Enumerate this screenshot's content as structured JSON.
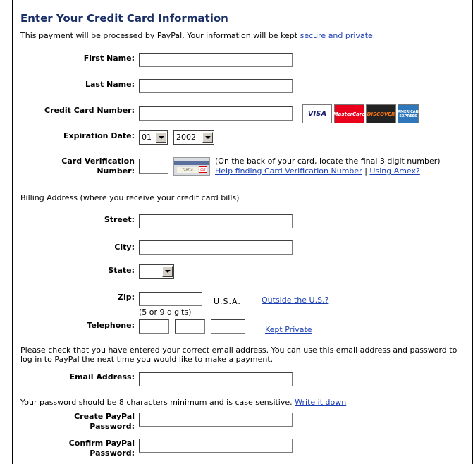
{
  "header": {
    "title": "Enter Your Credit Card Information",
    "intro_text": "This payment will be processed by PayPal. Your information will be kept",
    "intro_link": "secure and private."
  },
  "card_section": {
    "first_name_label": "First Name:",
    "last_name_label": "Last Name:",
    "card_number_label": "Credit Card Number:",
    "card_logos": [
      "VISA",
      "MasterCard",
      "DISCOVER",
      "AMERICAN EXPRESS"
    ],
    "expiration_label": "Expiration Date:",
    "exp_month": "01",
    "exp_year": "2002",
    "cvv_label_line1": "Card Verification",
    "cvv_label_line2": "Number:",
    "cvv_card_digits": "719718",
    "cvv_card_code": "017",
    "cvv_help_text": "(On the back of your card, locate the final 3 digit number)",
    "cvv_help_link": "Help finding Card Verification Number",
    "separator": "|",
    "amex_link": "Using Amex?"
  },
  "billing": {
    "heading": "Billing Address (where you receive your credit card bills)",
    "street_label": "Street:",
    "city_label": "City:",
    "state_label": "State:",
    "zip_label": "Zip:",
    "country_text": "U.S.A.",
    "outside_link": "Outside the U.S.?",
    "zip_hint": "(5 or 9 digits)",
    "telephone_label": "Telephone:",
    "kept_private_link": "Kept Private"
  },
  "account": {
    "email_note": "Please check that you have entered your correct email address. You can use this email address and password to log in to PayPal the next time you would like to make a payment.",
    "email_label": "Email Address:",
    "password_note": "Your password should be 8 characters minimum and is case sensitive.",
    "write_it_down_link": "Write it down",
    "create_pw_line1": "Create PayPal",
    "create_pw_line2": "Password:",
    "confirm_pw_line1": "Confirm PayPal",
    "confirm_pw_line2": "Password:"
  },
  "colors": {
    "title": "#1a2f66",
    "link": "#1b3fb3",
    "visa": "#1a1f71",
    "mastercard": "#eb001b",
    "discover": "#f47216",
    "amex": "#2e77bb"
  }
}
